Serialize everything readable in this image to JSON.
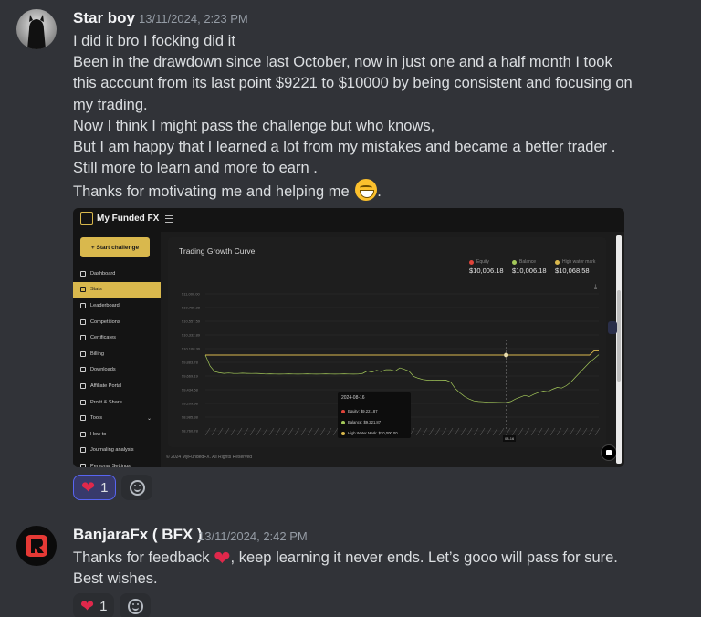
{
  "messages": [
    {
      "username": "Star boy",
      "timestamp": "13/11/2024, 2:23 PM",
      "lines": [
        "I did it bro I focking did it",
        "Been in the drawdown since last October, now in just one and a half month I took",
        "this account from its last point $9221 to $10000 by being consistent and focusing on",
        "my trading.",
        "Now I think I might pass the challenge but who knows,",
        "But I am happy that I learned a lot from my mistakes and became a better trader .",
        "Still more to learn and more to earn .",
        "Thanks for motivating me and helping me",
        "."
      ],
      "reaction_count": "1"
    },
    {
      "username": "BanjaraFx ( BFX )",
      "timestamp": "13/11/2024, 2:42 PM",
      "line1_before": "Thanks for feedback ",
      "line1_after": ", keep learning it never ends. Let’s gooo will pass for sure.",
      "line2": "Best wishes.",
      "reaction_count": "1"
    }
  ],
  "embed": {
    "brand": "My Funded FX",
    "start_button": "+ Start challenge",
    "nav": [
      {
        "label": "Dashboard",
        "icon": "flask-icon"
      },
      {
        "label": "Stats",
        "icon": "stats-icon"
      },
      {
        "label": "Leaderboard",
        "icon": "leaderboard-icon"
      },
      {
        "label": "Competitions",
        "icon": "competitions-icon"
      },
      {
        "label": "Certificates",
        "icon": "certificate-icon"
      },
      {
        "label": "Billing",
        "icon": "billing-icon"
      },
      {
        "label": "Downloads",
        "icon": "download-icon"
      },
      {
        "label": "Affiliate Portal",
        "icon": "affiliate-icon"
      },
      {
        "label": "Profit & Share",
        "icon": "profit-icon"
      },
      {
        "label": "Tools",
        "icon": "tools-icon"
      },
      {
        "label": "How to",
        "icon": "howto-icon"
      },
      {
        "label": "Journaling analysis",
        "icon": "journal-icon"
      },
      {
        "label": "Personal Settings",
        "icon": "settings-icon"
      }
    ],
    "panel_title": "Trading Growth Curve",
    "legend": [
      {
        "name": "Equity",
        "value": "$10,006.18",
        "color": "#e0443a"
      },
      {
        "name": "Balance",
        "value": "$10,006.18",
        "color": "#a4c95a"
      },
      {
        "name": "High water mark",
        "value": "$10,068.58",
        "color": "#d9b84d"
      }
    ],
    "tooltip": {
      "date": "2024-08-16",
      "rows": [
        {
          "label": "Equity: $9,221.87",
          "color": "#e0443a"
        },
        {
          "label": "Balance: $9,221.87",
          "color": "#a4c95a"
        },
        {
          "label": "High Water Mark: $10,000.00",
          "color": "#d9b84d"
        }
      ],
      "x_label": "08-16"
    },
    "copyright": "© 2024 MyFundedFX. All Rights Reserved"
  },
  "chart_data": {
    "type": "line",
    "title": "Trading Growth Curve",
    "y_ticks": [
      "$11,000.00",
      "$10,765.28",
      "$10,557.59",
      "$10,332.89",
      "$10,108.30",
      "$9,883.78",
      "$9,669.19",
      "$9,434.58",
      "$9,209.98",
      "$8,985.38",
      "$8,760.78"
    ],
    "ylim": [
      8760.78,
      11000
    ],
    "x_index_range": [
      0,
      85
    ],
    "series": [
      {
        "name": "High water mark",
        "color": "#d9b84d",
        "values": [
          10000,
          10000,
          10000,
          10000,
          10000,
          10000,
          10000,
          10000,
          10000,
          10000,
          10000,
          10000,
          10000,
          10000,
          10000,
          10000,
          10000,
          10000,
          10000,
          10000,
          10000,
          10000,
          10000,
          10000,
          10000,
          10000,
          10000,
          10000,
          10000,
          10000,
          10000,
          10000,
          10000,
          10000,
          10000,
          10000,
          10000,
          10000,
          10000,
          10000,
          10000,
          10000,
          10000,
          10000,
          10000,
          10000,
          10000,
          10000,
          10000,
          10000,
          10000,
          10000,
          10000,
          10000,
          10000,
          10000,
          10000,
          10000,
          10000,
          10000,
          10000,
          10000,
          10000,
          10000,
          10000,
          10000,
          10000,
          10000,
          10000,
          10000,
          10000,
          10000,
          10000,
          10000,
          10000,
          10000,
          10000,
          10000,
          10000,
          10000,
          10000,
          10000,
          10000,
          10000,
          10068.58,
          10068.58
        ]
      },
      {
        "name": "Balance",
        "color": "#a4c95a",
        "values": [
          10000,
          9820,
          9730,
          9710,
          9700,
          9705,
          9700,
          9698,
          9702,
          9700,
          9698,
          9700,
          9695,
          9690,
          9692,
          9690,
          9688,
          9690,
          9692,
          9690,
          9688,
          9690,
          9692,
          9690,
          9688,
          9690,
          9692,
          9690,
          9688,
          9690,
          9692,
          9690,
          9688,
          9690,
          9700,
          9740,
          9720,
          9750,
          9730,
          9760,
          9760,
          9735,
          9790,
          9765,
          9735,
          9650,
          9620,
          9600,
          9590,
          9592,
          9590,
          9588,
          9590,
          9560,
          9450,
          9380,
          9320,
          9280,
          9250,
          9240,
          9235,
          9230,
          9228,
          9225,
          9223,
          9221.87,
          9240,
          9280,
          9310,
          9340,
          9320,
          9360,
          9390,
          9410,
          9400,
          9440,
          9470,
          9460,
          9500,
          9560,
          9640,
          9720,
          9800,
          9880,
          9940,
          10006.18
        ]
      }
    ]
  }
}
